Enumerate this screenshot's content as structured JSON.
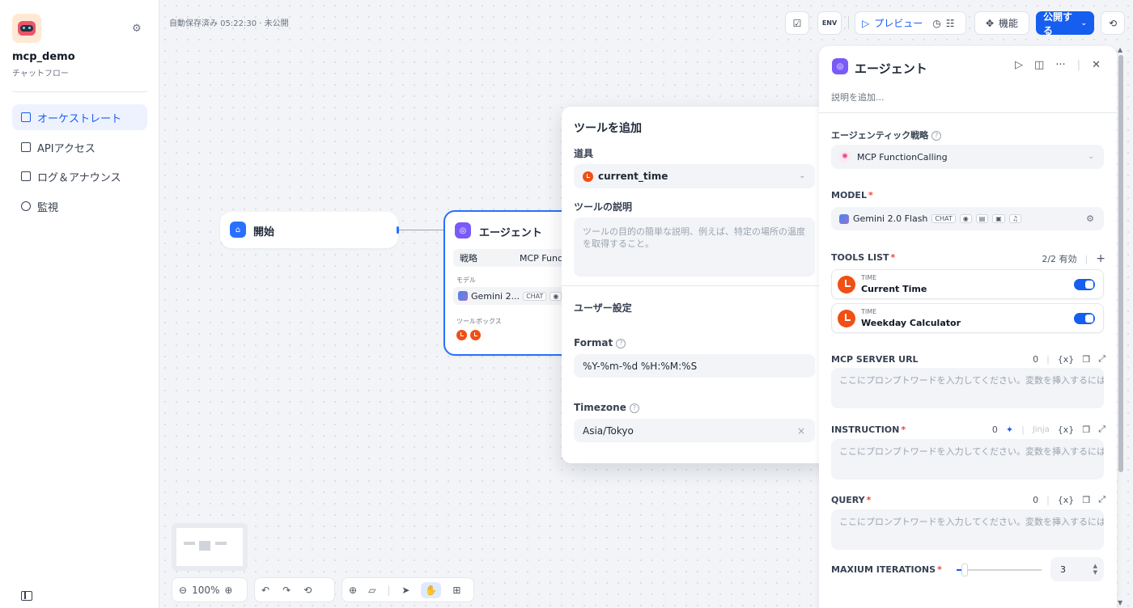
{
  "app": {
    "name": "mcp_demo",
    "type": "チャットフロー"
  },
  "sidebar": {
    "items": [
      {
        "label": "オーケストレート",
        "active": true
      },
      {
        "label": "APIアクセス"
      },
      {
        "label": "ログ＆アナウンス"
      },
      {
        "label": "監視"
      }
    ]
  },
  "canvas": {
    "autosave": "自動保存済み 05:22:30 · 未公開"
  },
  "toolbar": {
    "preview": "プレビュー",
    "features": "機能",
    "publish": "公開する",
    "env_label": "ENV"
  },
  "nodes": {
    "start": {
      "title": "開始"
    },
    "agent": {
      "title": "エージェント",
      "strategy_label": "戦略",
      "strategy_value": "MCP Func",
      "model_label": "モデル",
      "model_value": "Gemini 2...",
      "model_chip": "CHAT",
      "toolbox_label": "ツールボックス"
    }
  },
  "popup": {
    "title": "ツールを追加",
    "tool_label": "道具",
    "tool_value": "current_time",
    "desc_label": "ツールの説明",
    "desc_placeholder": "ツールの目的の簡単な説明、例えば、特定の場所の温度を取得すること。",
    "user_settings": "ユーザー設定",
    "format_label": "Format",
    "format_value": "%Y-%m-%d %H:%M:%S",
    "timezone_label": "Timezone",
    "timezone_value": "Asia/Tokyo"
  },
  "panel": {
    "title": "エージェント",
    "desc_placeholder": "説明を追加...",
    "strategy_label": "エージェンティック戦略",
    "strategy_value": "MCP FunctionCalling",
    "model_label": "MODEL",
    "model_value": "Gemini 2.0 Flash",
    "model_chip": "CHAT",
    "tools_label": "TOOLS LIST",
    "tools_count": "2/2 有効",
    "tools": [
      {
        "category": "TIME",
        "name": "Current Time",
        "enabled": true
      },
      {
        "category": "TIME",
        "name": "Weekday Calculator",
        "enabled": true
      }
    ],
    "mcp_label": "MCP SERVER URL",
    "mcp_count": "0",
    "prompt_placeholder": "ここにプロンプトワードを入力してください。変数を挿入するには「{」を、...",
    "instruction_label": "INSTRUCTION",
    "instruction_count": "0",
    "jinja_label": "Jinja",
    "query_label": "QUERY",
    "query_count": "0",
    "iterations_label": "MAXIUM ITERATIONS",
    "iterations_value": "3",
    "var_icon": "{x}"
  },
  "zoom": {
    "level": "100%"
  },
  "colors": {
    "accent": "#155eef",
    "tool": "#f04f15",
    "agent": "#7a5af8"
  }
}
